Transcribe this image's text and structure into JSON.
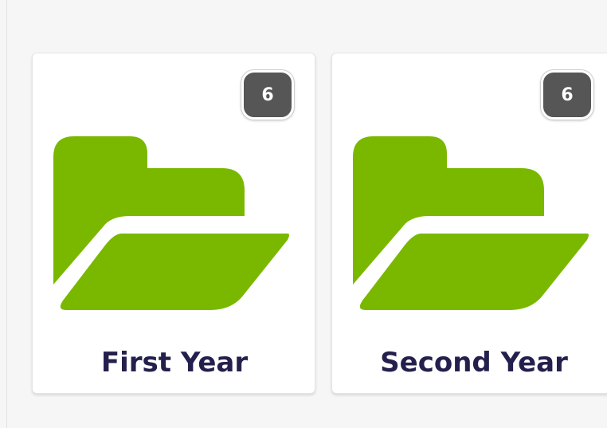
{
  "colors": {
    "folder": "#7ab800",
    "badge": "#565656",
    "label": "#24204d"
  },
  "folders": [
    {
      "label": "First Year",
      "count": "6",
      "icon": "folder-open-icon"
    },
    {
      "label": "Second Year",
      "count": "6",
      "icon": "folder-open-icon"
    }
  ]
}
